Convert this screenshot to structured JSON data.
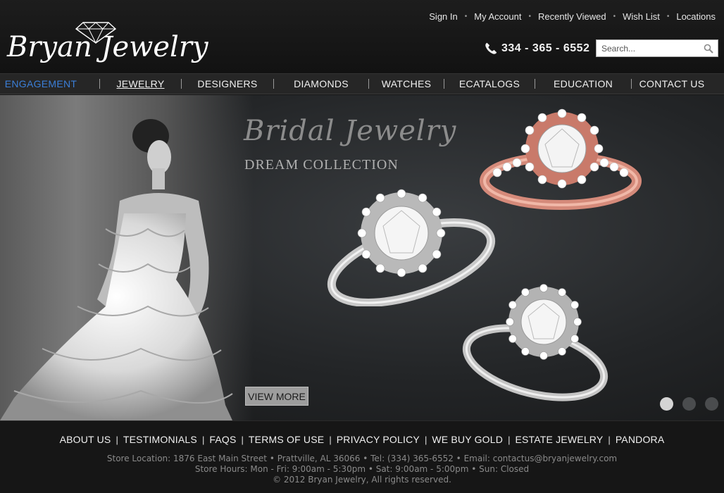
{
  "brand": {
    "name": "Bryan Jewelry"
  },
  "top_links": [
    "Sign In",
    "My Account",
    "Recently Viewed",
    "Wish List",
    "Locations"
  ],
  "phone": "334 - 365 - 6552",
  "search": {
    "placeholder": "Search..."
  },
  "nav": [
    {
      "label": "ENGAGEMENT",
      "active": true
    },
    {
      "label": "JEWELRY",
      "underlined": true
    },
    {
      "label": "DESIGNERS"
    },
    {
      "label": "DIAMONDS"
    },
    {
      "label": "WATCHES"
    },
    {
      "label": "ECATALOGS"
    },
    {
      "label": "EDUCATION"
    },
    {
      "label": "CONTACT US"
    }
  ],
  "banner": {
    "title": "Bridal Jewelry",
    "subtitle": "DREAM COLLECTION",
    "cta": "VIEW MORE",
    "slides": 3,
    "active_slide": 1
  },
  "footer": {
    "links": [
      "ABOUT US",
      "TESTIMONIALS",
      "FAQS",
      "TERMS OF USE",
      "PRIVACY POLICY",
      "WE BUY GOLD",
      "ESTATE JEWELRY",
      "PANDORA"
    ],
    "address": "Store Location: 1876 East Main Street • Prattville,  AL  36066 • Tel: (334) 365-6552 • Email: contactus@bryanjewelry.com",
    "hours": "Store Hours: Mon - Fri: 9:00am - 5:30pm • Sat: 9:00am - 5:00pm • Sun: Closed",
    "copyright": "© 2012 Bryan Jewelry, All rights reserved."
  },
  "colors": {
    "accent_active_nav": "#3b7fd8",
    "rose_gold": "#d58a7a"
  },
  "icons": [
    "diamond-logo-icon",
    "phone-icon",
    "search-icon"
  ]
}
